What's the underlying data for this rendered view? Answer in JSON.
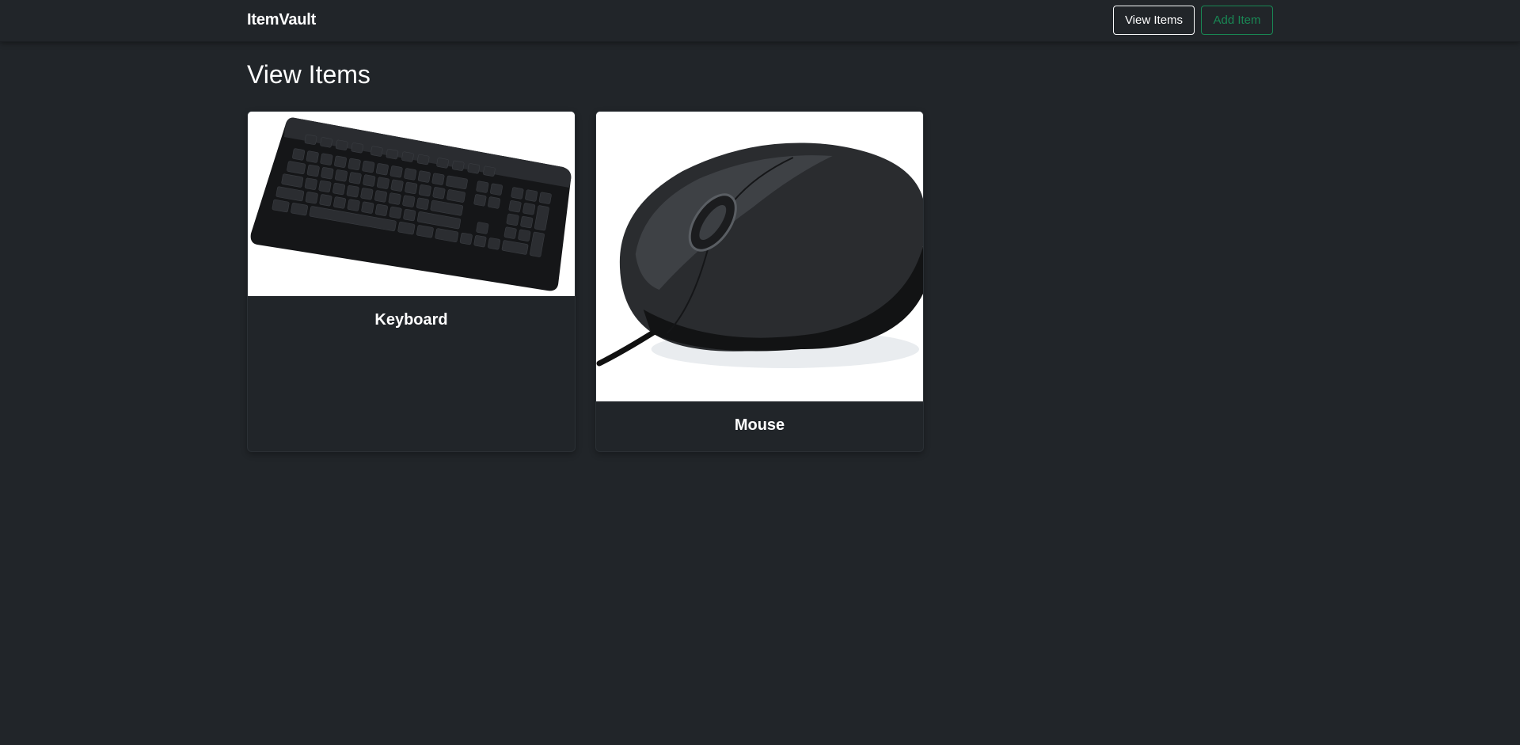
{
  "navbar": {
    "brand": "ItemVault",
    "view_items_label": "View Items",
    "add_item_label": "Add Item"
  },
  "page": {
    "title": "View Items"
  },
  "items": [
    {
      "name": "Keyboard",
      "image_icon": "keyboard-image"
    },
    {
      "name": "Mouse",
      "image_icon": "mouse-image"
    }
  ],
  "colors": {
    "background": "#212529",
    "text": "#ffffff",
    "outline_light": "#f8f9fa",
    "success": "#198754",
    "card_border": "#2b3035"
  }
}
